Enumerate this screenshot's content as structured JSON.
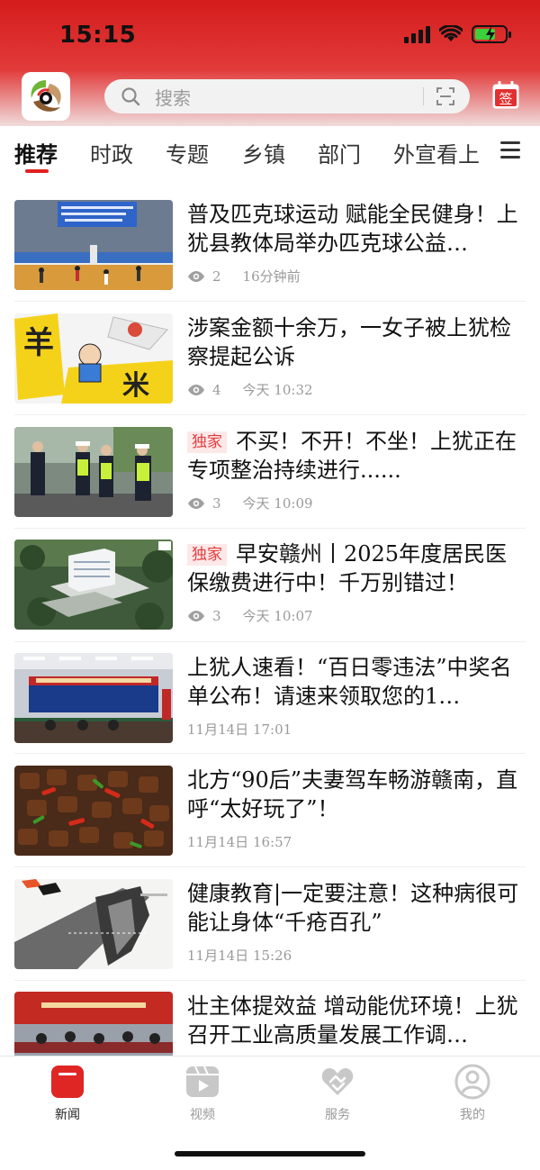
{
  "status": {
    "time": "15:15"
  },
  "search": {
    "placeholder": "搜索"
  },
  "header": {
    "sign_label": "签"
  },
  "tabs": [
    {
      "label": "推荐",
      "active": true
    },
    {
      "label": "时政"
    },
    {
      "label": "专题"
    },
    {
      "label": "乡镇"
    },
    {
      "label": "部门"
    },
    {
      "label": "外宣看上"
    }
  ],
  "articles": [
    {
      "title": "普及匹克球运动 赋能全民健身！上犹县教体局举办匹克球公益…",
      "views": "2",
      "time": "16分钟前"
    },
    {
      "title": "涉案金额十余万，一女子被上犹检察提起公诉",
      "views": "4",
      "time": "今天 10:32"
    },
    {
      "badge": "独家",
      "title": "不买！不开！不坐！上犹正在专项整治持续进行......",
      "views": "3",
      "time": "今天 10:09"
    },
    {
      "badge": "独家",
      "title": "早安赣州丨2025年度居民医保缴费进行中！千万别错过！",
      "views": "3",
      "time": "今天 10:07"
    },
    {
      "title": "上犹人速看！“百日零违法”中奖名单公布！请速来领取您的1…",
      "time": "11月14日  17:01"
    },
    {
      "title": "北方“90后”夫妻驾车畅游赣南，直呼“太好玩了”！",
      "time": "11月14日  16:57"
    },
    {
      "title": "健康教育|一定要注意！这种病很可能让身体“千疮百孔”",
      "time": "11月14日  15:26"
    },
    {
      "title": "壮主体提效益 增动能优环境！上犹召开工业高质量发展工作调…"
    }
  ],
  "bottom_nav": [
    {
      "label": "新闻",
      "active": true
    },
    {
      "label": "视频"
    },
    {
      "label": "服务"
    },
    {
      "label": "我的"
    }
  ],
  "colors": {
    "brand": "#d41c1c",
    "badge_text": "#e33a3a",
    "badge_bg": "#fde8e8"
  }
}
